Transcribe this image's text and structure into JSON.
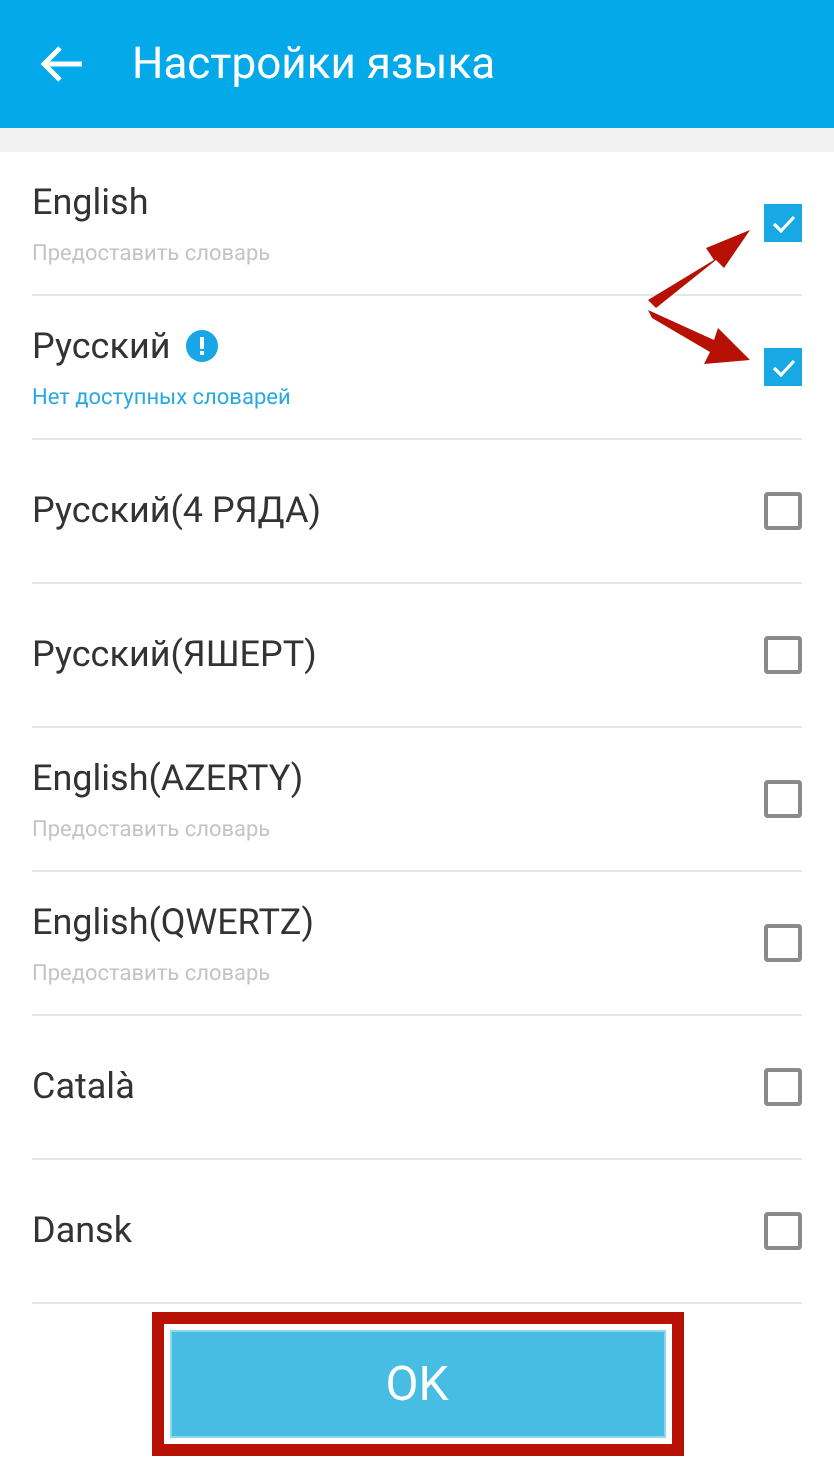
{
  "header": {
    "title": "Настройки языка"
  },
  "languages": [
    {
      "name": "English",
      "subtitle": {
        "text": "Предоставить словарь",
        "kind": "hint"
      },
      "info": false,
      "checked": true
    },
    {
      "name": "Русский",
      "subtitle": {
        "text": "Нет доступных словарей",
        "kind": "warning"
      },
      "info": true,
      "checked": true
    },
    {
      "name": "Русский(4 РЯДА)",
      "info": false,
      "checked": false
    },
    {
      "name": "Русский(ЯШЕРТ)",
      "info": false,
      "checked": false
    },
    {
      "name": "English(AZERTY)",
      "subtitle": {
        "text": "Предоставить словарь",
        "kind": "hint"
      },
      "info": false,
      "checked": false
    },
    {
      "name": "English(QWERTZ)",
      "subtitle": {
        "text": "Предоставить словарь",
        "kind": "hint"
      },
      "info": false,
      "checked": false
    },
    {
      "name": "Català",
      "info": false,
      "checked": false
    },
    {
      "name": "Dansk",
      "info": false,
      "checked": false
    }
  ],
  "ok_button": {
    "label": "OK"
  }
}
